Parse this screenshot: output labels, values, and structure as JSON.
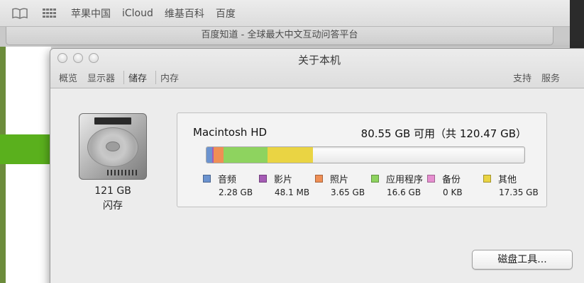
{
  "browser": {
    "bookmarks": [
      "苹果中国",
      "iCloud",
      "维基百科",
      "百度"
    ],
    "tab_title": "百度知道 - 全球最大中文互动问答平台"
  },
  "window": {
    "title": "关于本机",
    "tabs": [
      "概览",
      "显示器",
      "储存",
      "内存"
    ],
    "active_tab": "储存",
    "right_links": [
      "支持",
      "服务"
    ]
  },
  "drive": {
    "capacity": "121 GB",
    "type": "闪存"
  },
  "storage": {
    "disk_name": "Macintosh HD",
    "free_text": "80.55 GB 可用（共 120.47 GB）",
    "total_gb": 120.47,
    "categories": [
      {
        "label": "音频",
        "size": "2.28 GB",
        "gb": 2.28,
        "color": "#6b93cf"
      },
      {
        "label": "影片",
        "size": "48.1 MB",
        "gb": 0.048,
        "color": "#a55bb5"
      },
      {
        "label": "照片",
        "size": "3.65 GB",
        "gb": 3.65,
        "color": "#ef8f55"
      },
      {
        "label": "应用程序",
        "size": "16.6 GB",
        "gb": 16.6,
        "color": "#8ed35f"
      },
      {
        "label": "备份",
        "size": "0 KB",
        "gb": 0,
        "color": "#e68fd0"
      },
      {
        "label": "其他",
        "size": "17.35 GB",
        "gb": 17.35,
        "color": "#ead443"
      }
    ]
  },
  "buttons": {
    "disk_utility": "磁盘工具..."
  }
}
